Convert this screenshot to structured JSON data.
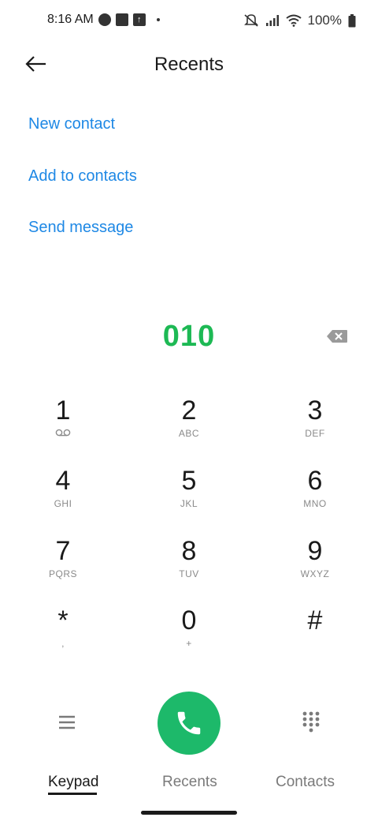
{
  "status_bar": {
    "time": "8:16 AM",
    "battery": "100%",
    "icons": [
      "alarm-icon",
      "square-notification-icon",
      "upload-notification-icon",
      "dot-icon",
      "mute-icon",
      "signal-icon",
      "wifi-icon",
      "battery-icon"
    ]
  },
  "header": {
    "title": "Recents",
    "back_icon": "back-arrow-icon"
  },
  "actions": {
    "new_contact": "New contact",
    "add_to_contacts": "Add to contacts",
    "send_message": "Send message"
  },
  "dialer": {
    "number": "010",
    "backspace_icon": "backspace-icon"
  },
  "keypad": [
    {
      "digit": "1",
      "letters": ""
    },
    {
      "digit": "2",
      "letters": "ABC"
    },
    {
      "digit": "3",
      "letters": "DEF"
    },
    {
      "digit": "4",
      "letters": "GHI"
    },
    {
      "digit": "5",
      "letters": "JKL"
    },
    {
      "digit": "6",
      "letters": "MNO"
    },
    {
      "digit": "7",
      "letters": "PQRS"
    },
    {
      "digit": "8",
      "letters": "TUV"
    },
    {
      "digit": "9",
      "letters": "WXYZ"
    },
    {
      "digit": "*",
      "letters": ","
    },
    {
      "digit": "0",
      "letters": "+"
    },
    {
      "digit": "#",
      "letters": ""
    }
  ],
  "bottom_actions": {
    "menu_icon": "menu-icon",
    "call_icon": "phone-icon",
    "dialpad_icon": "dialpad-icon",
    "call_color": "#1db96a"
  },
  "tabs": [
    {
      "label": "Keypad",
      "active": true
    },
    {
      "label": "Recents",
      "active": false
    },
    {
      "label": "Contacts",
      "active": false
    }
  ],
  "colors": {
    "accent_link": "#1e88e5",
    "dialed_number": "#1db954"
  }
}
